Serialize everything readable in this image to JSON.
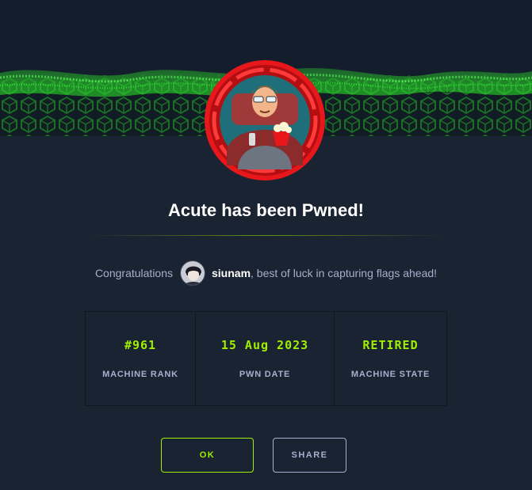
{
  "banner": {
    "accent": "#2ee62e"
  },
  "machine": {
    "title": "Acute has been Pwned!"
  },
  "congrats": {
    "prefix": "Congratulations",
    "username": "siunam",
    "suffix": ", best of luck in capturing flags ahead!"
  },
  "stats": [
    {
      "value": "#961",
      "label": "MACHINE RANK"
    },
    {
      "value": "15 Aug 2023",
      "label": "PWN DATE"
    },
    {
      "value": "RETIRED",
      "label": "MACHINE STATE"
    }
  ],
  "buttons": {
    "ok_label": "OK",
    "share_label": "SHARE"
  },
  "colors": {
    "background": "#1a2332",
    "accent": "#9fef00",
    "ring": "#e8171c"
  }
}
